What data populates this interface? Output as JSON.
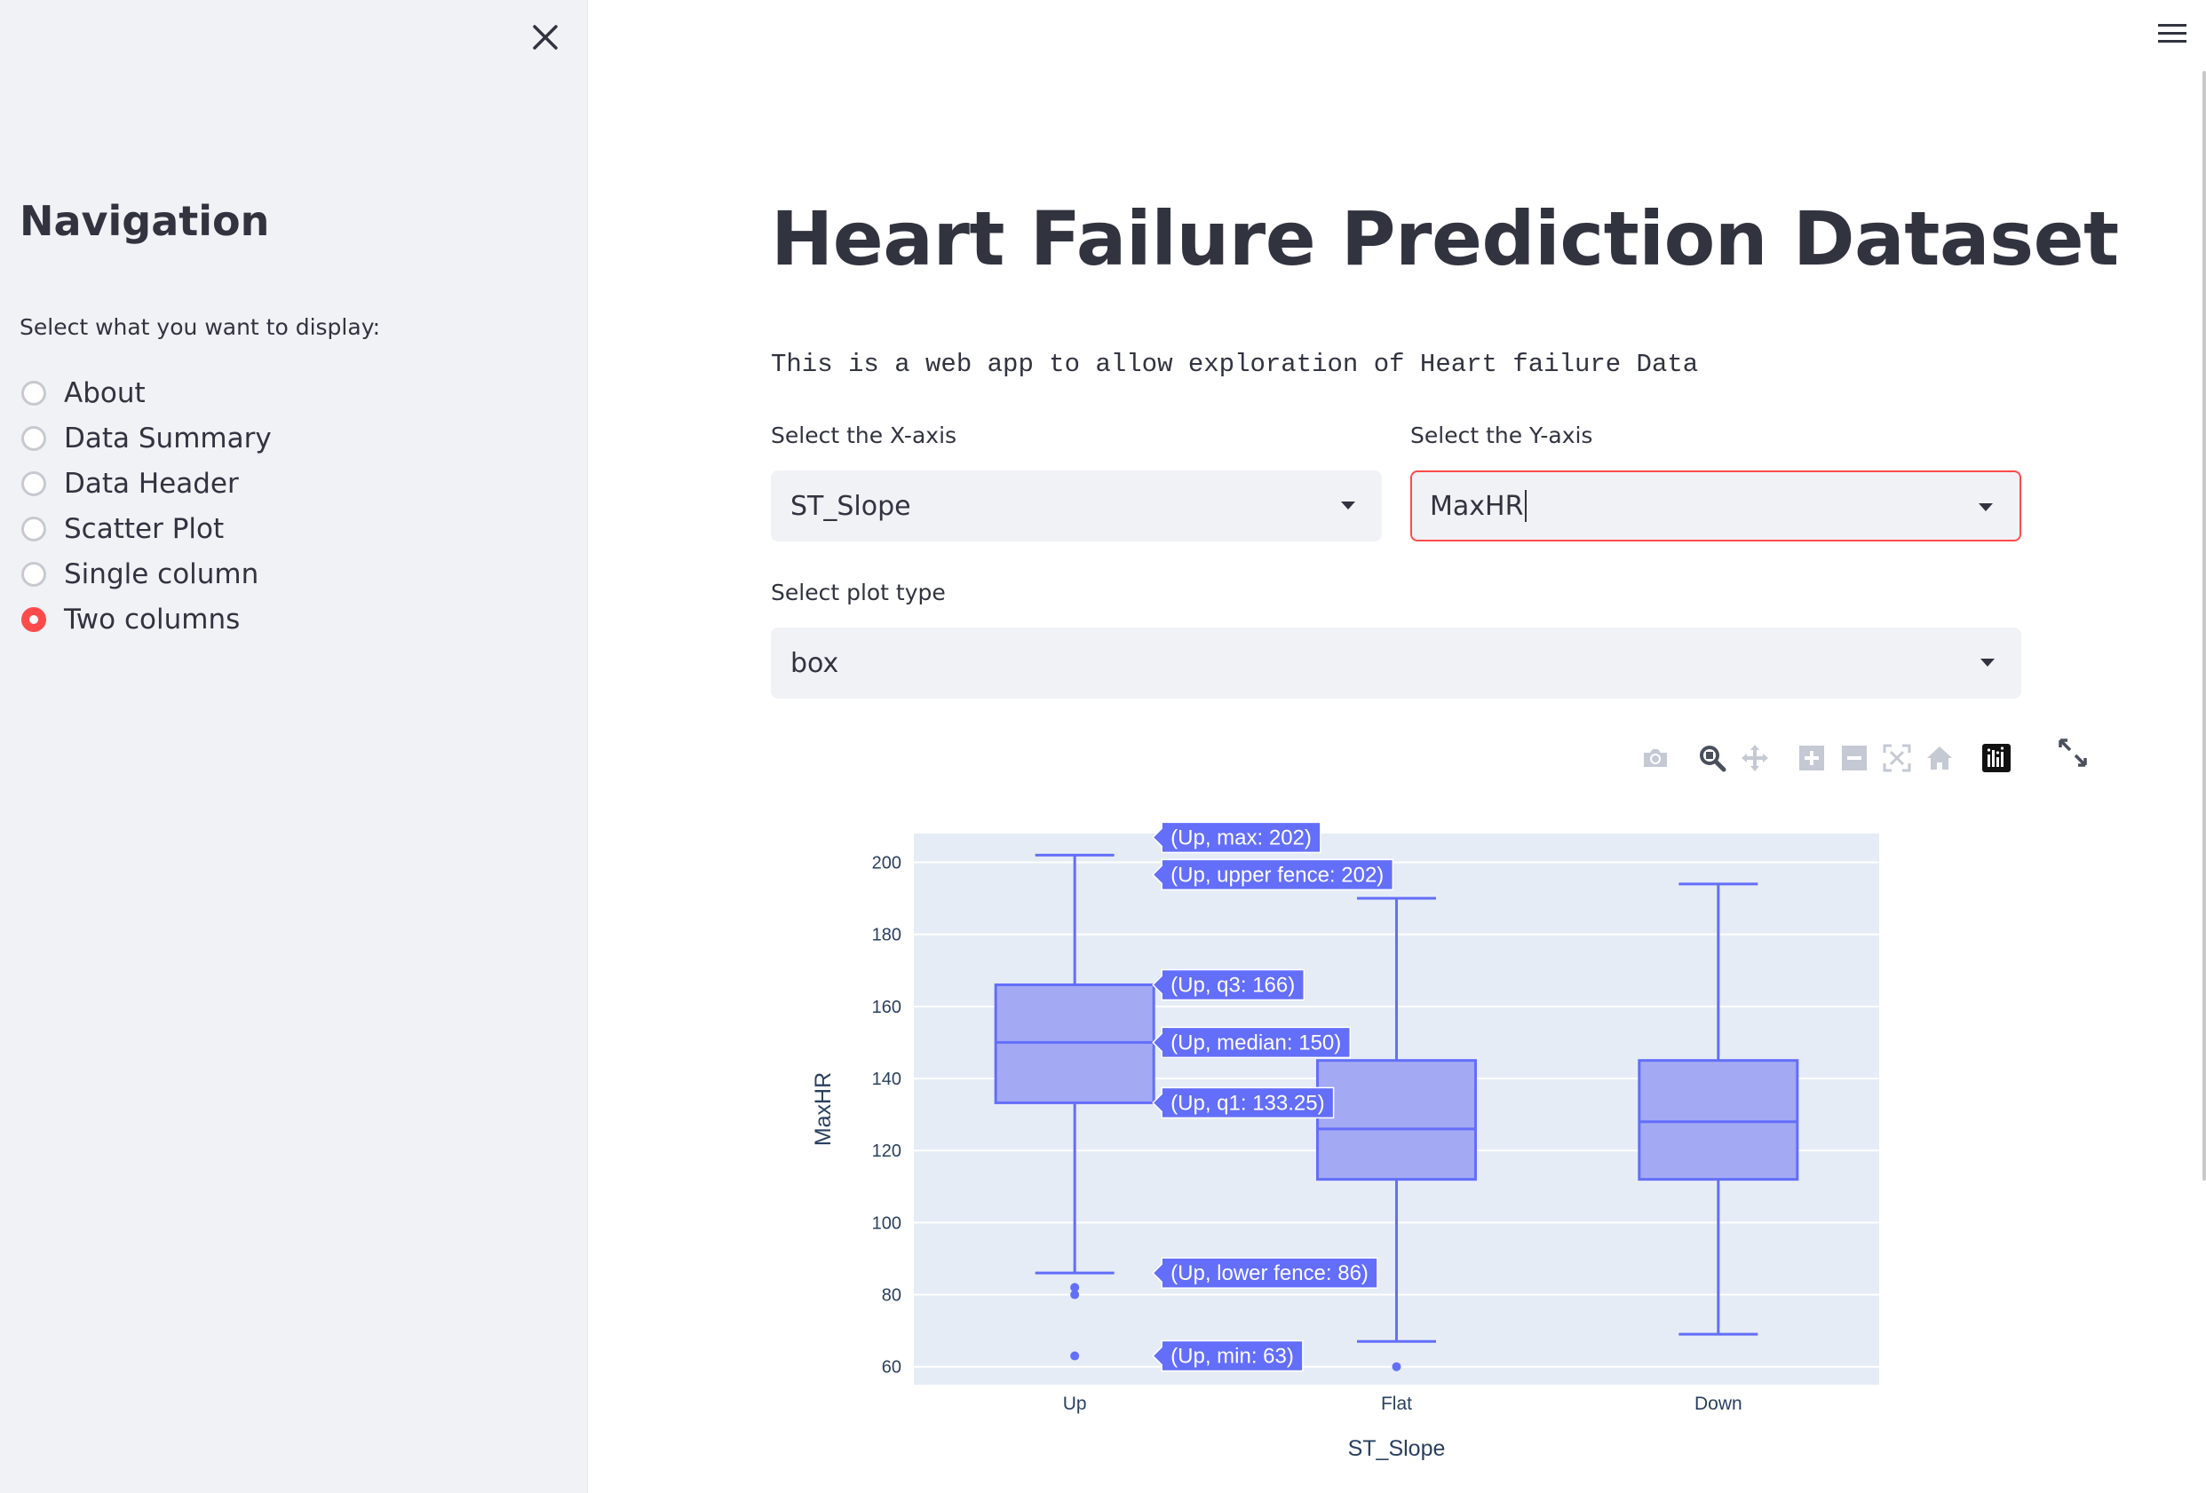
{
  "sidebar": {
    "title": "Navigation",
    "prompt": "Select what you want to display:",
    "options": [
      {
        "label": "About",
        "selected": false
      },
      {
        "label": "Data Summary",
        "selected": false
      },
      {
        "label": "Data Header",
        "selected": false
      },
      {
        "label": "Scatter Plot",
        "selected": false
      },
      {
        "label": "Single column",
        "selected": false
      },
      {
        "label": "Two columns",
        "selected": true
      }
    ]
  },
  "main": {
    "title": "Heart Failure Prediction Dataset",
    "description": "This is a web app to allow exploration of Heart failure Data",
    "x_axis_select": {
      "label": "Select the X-axis",
      "value": "ST_Slope"
    },
    "y_axis_select": {
      "label": "Select the Y-axis",
      "value": "MaxHR"
    },
    "plot_type_select": {
      "label": "Select plot type",
      "value": "box"
    }
  },
  "icons": {
    "close": "close-icon",
    "menu": "hamburger-menu-icon",
    "modebar": [
      "camera-icon",
      "zoom-icon",
      "pan-icon",
      "zoom-in-icon",
      "zoom-out-icon",
      "autoscale-icon",
      "reset-axes-icon",
      "plotly-logo-icon"
    ],
    "expand": "fullscreen-icon"
  },
  "colors": {
    "accent": "#ff4b4b",
    "sidebar_bg": "#f0f2f6",
    "box_fill": "#a3aaf3",
    "box_line": "#636efa",
    "plot_bg": "#e5ecf6"
  },
  "chart_data": {
    "type": "box",
    "xlabel": "ST_Slope",
    "ylabel": "MaxHR",
    "ylim": [
      55,
      208
    ],
    "yticks": [
      60,
      80,
      100,
      120,
      140,
      160,
      180,
      200
    ],
    "categories": [
      "Up",
      "Flat",
      "Down"
    ],
    "boxes": [
      {
        "name": "Up",
        "min": 86,
        "q1": 133.25,
        "median": 150,
        "q3": 166,
        "max": 202,
        "outliers": [
          82,
          80,
          63
        ]
      },
      {
        "name": "Flat",
        "min": 67,
        "q1": 112,
        "median": 126,
        "q3": 145,
        "max": 190,
        "outliers": [
          60
        ]
      },
      {
        "name": "Down",
        "min": 69,
        "q1": 112,
        "median": 128,
        "q3": 145,
        "max": 194,
        "outliers": []
      }
    ],
    "hover_labels": [
      {
        "text": "(Up, max: 202)",
        "value": 202
      },
      {
        "text": "(Up, upper fence: 202)",
        "value": 202
      },
      {
        "text": "(Up, q3: 166)",
        "value": 166
      },
      {
        "text": "(Up, median: 150)",
        "value": 150
      },
      {
        "text": "(Up, q1: 133.25)",
        "value": 133.25
      },
      {
        "text": "(Up, lower fence: 86)",
        "value": 86
      },
      {
        "text": "(Up, min: 63)",
        "value": 63
      }
    ]
  }
}
